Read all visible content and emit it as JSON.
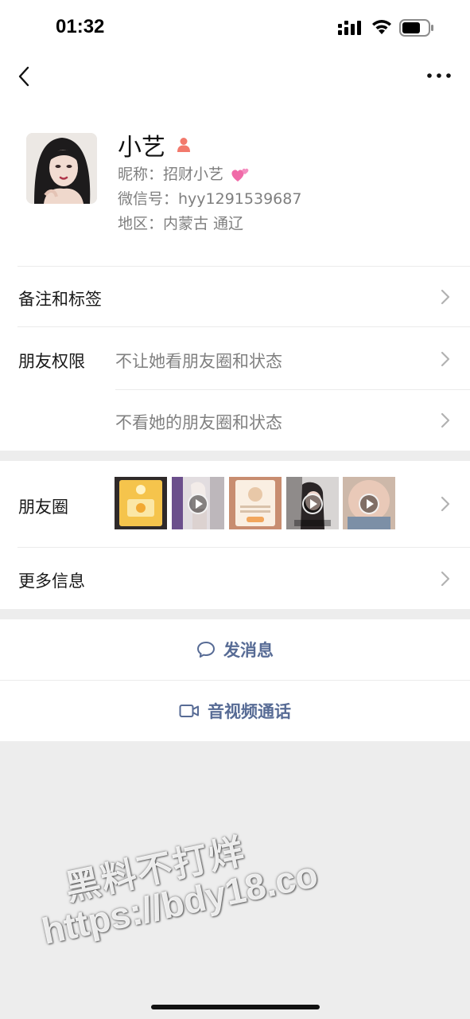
{
  "status_bar": {
    "time": "01:32"
  },
  "profile": {
    "name": "小艺",
    "nickname_label": "昵称：",
    "nickname": "招财小艺",
    "wechat_id_label": "微信号：",
    "wechat_id": "hyy1291539687",
    "region_label": "地区：",
    "region": "内蒙古 通辽"
  },
  "rows": {
    "remark_tags": "备注和标签",
    "friend_permissions": "朋友权限",
    "perm_hide_mine": "不让她看朋友圈和状态",
    "perm_hide_theirs": "不看她的朋友圈和状态",
    "moments": "朋友圈",
    "more_info": "更多信息"
  },
  "moments_thumbs": [
    {
      "kind": "image",
      "color": "#f0c24a"
    },
    {
      "kind": "video",
      "color": "#c9c3c8"
    },
    {
      "kind": "image",
      "color": "#f2d9b8"
    },
    {
      "kind": "video",
      "color": "#6e6a6c"
    },
    {
      "kind": "video",
      "color": "#d9b6a3"
    }
  ],
  "actions": {
    "send_message": "发消息",
    "video_call": "音视频通话"
  },
  "watermark": {
    "line1": "黑料不打烊",
    "line2": "https://bdy18.co"
  },
  "colors": {
    "link_blue": "#576b95",
    "gender_icon": "#f2796c",
    "background": "#ededed"
  }
}
